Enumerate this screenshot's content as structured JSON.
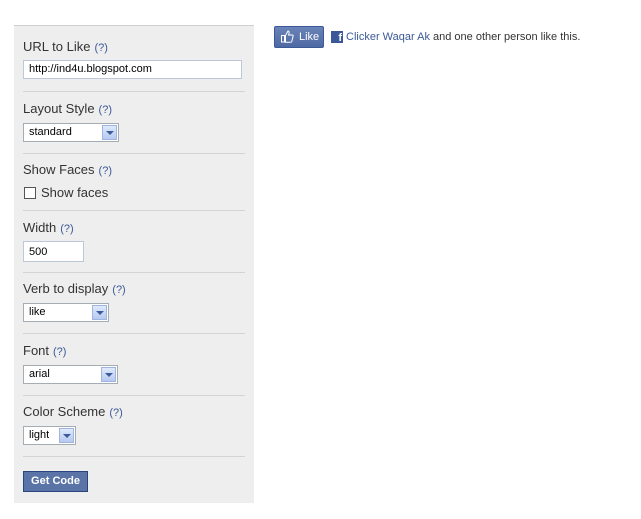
{
  "form": {
    "url": {
      "label": "URL to Like",
      "help": "(?)",
      "value": "http://ind4u.blogspot.com"
    },
    "layout": {
      "label": "Layout Style",
      "help": "(?)",
      "selected": "standard"
    },
    "faces": {
      "label": "Show Faces",
      "help": "(?)",
      "checkbox_label": "Show faces",
      "checked": false
    },
    "width": {
      "label": "Width",
      "help": "(?)",
      "value": "500"
    },
    "verb": {
      "label": "Verb to display",
      "help": "(?)",
      "selected": "like"
    },
    "font": {
      "label": "Font",
      "help": "(?)",
      "selected": "arial"
    },
    "color": {
      "label": "Color Scheme",
      "help": "(?)",
      "selected": "light"
    },
    "submit_label": "Get Code"
  },
  "preview": {
    "like_label": "Like",
    "fb_icon": "f",
    "user_name": "Clicker Waqar Ak",
    "suffix": " and one other person like this."
  },
  "colors": {
    "link": "#3b5998",
    "button": "#5b74a8",
    "panel": "#eeeeee"
  }
}
